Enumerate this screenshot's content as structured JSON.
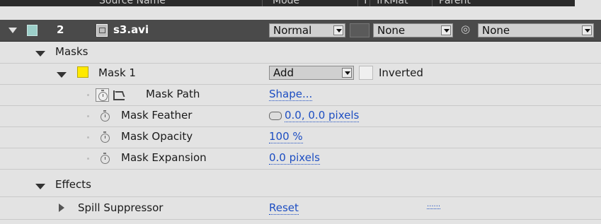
{
  "header": {
    "col_source": "Source Name",
    "col_mode": "Mode",
    "col_t": "T",
    "col_trkmat": "TrkMat",
    "col_parent": "Parent"
  },
  "layer": {
    "number": "2",
    "name": "s3.avi",
    "mode": "Normal",
    "trkmat": "None",
    "parent": "None",
    "label_color": "#9ccfc9"
  },
  "masks": {
    "group_label": "Masks",
    "mask1": {
      "name": "Mask 1",
      "color": "#ffea00",
      "mode": "Add",
      "inverted_label": "Inverted"
    },
    "props": [
      {
        "label": "Mask Path",
        "value": "Shape..."
      },
      {
        "label": "Mask Feather",
        "value": "0.0, 0.0 pixels"
      },
      {
        "label": "Mask Opacity",
        "value": "100 %"
      },
      {
        "label": "Mask Expansion",
        "value": "0.0 pixels"
      }
    ]
  },
  "effects": {
    "group_label": "Effects",
    "effect1": {
      "name": "Spill Suppressor",
      "reset": "Reset",
      "about": "......"
    }
  },
  "accent": "#1d4ec2"
}
